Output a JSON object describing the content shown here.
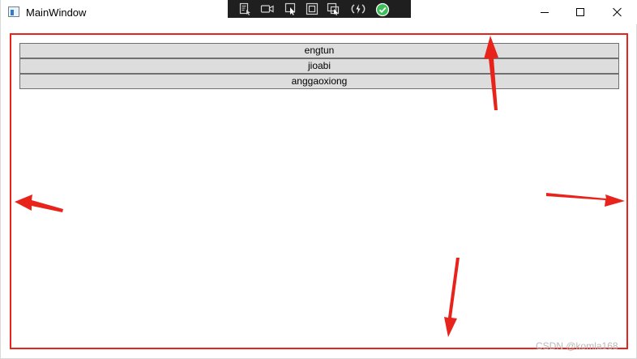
{
  "window": {
    "title": "MainWindow"
  },
  "devtools_toolbar": {
    "tools": [
      "live-visual-tree-icon",
      "select-element-camera-icon",
      "select-element-pointer-icon",
      "display-layout-adorners-icon",
      "track-focused-element-icon",
      "hot-reload-icon",
      "binding-failures-ok-icon"
    ]
  },
  "list": {
    "items": [
      "engtun",
      "jioabi",
      "anggaoxiong"
    ]
  },
  "annotation": {
    "color": "#e8231b"
  },
  "watermark": "CSDN @komla168"
}
